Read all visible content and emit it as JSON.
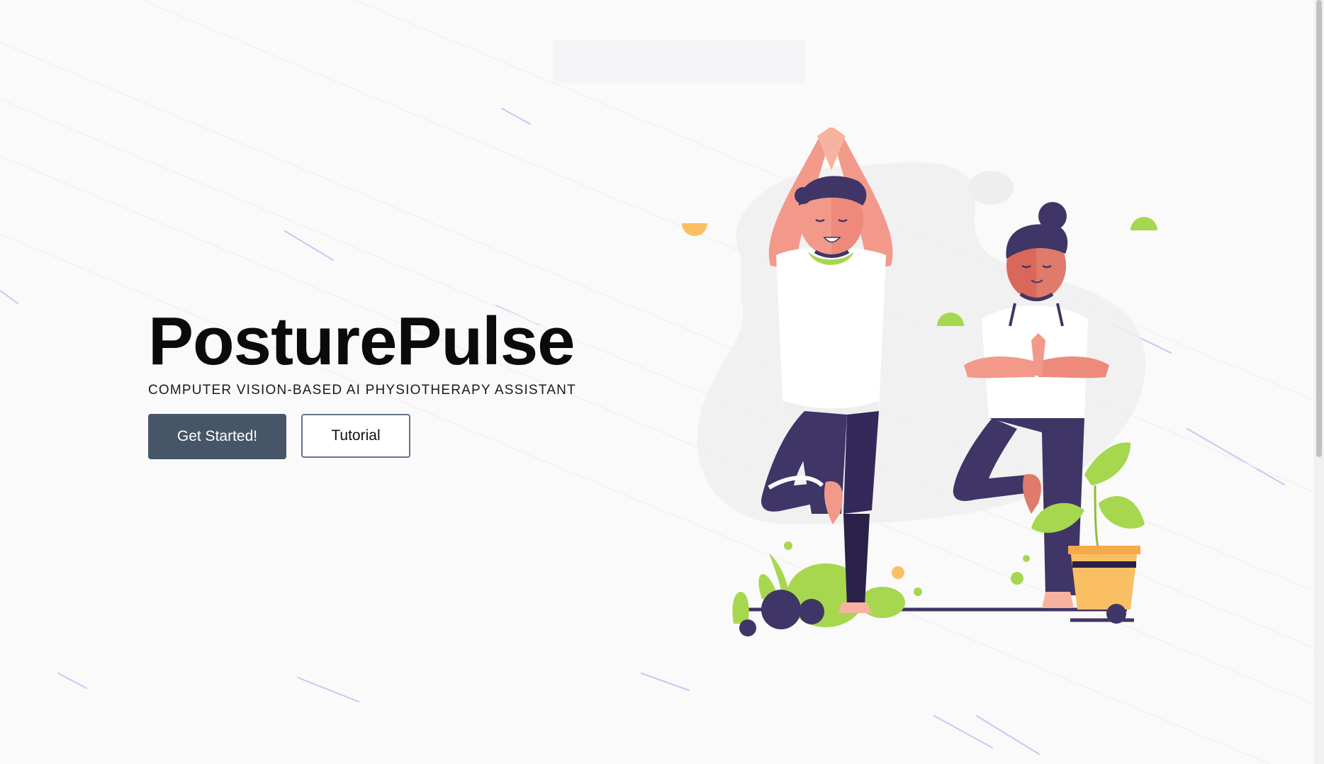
{
  "hero": {
    "title": "PosturePulse",
    "subtitle": "COMPUTER VISION-BASED AI PHYSIOTHERAPY ASSISTANT",
    "primary_button": "Get Started!",
    "secondary_button": "Tutorial"
  },
  "colors": {
    "background": "#fafafa",
    "primary_button": "#475569",
    "secondary_border": "#64748b",
    "title": "#0b0b0b",
    "figure_dark": "#3f3566",
    "skin": "#f2998a",
    "leaf_green": "#a6d74e",
    "pot_orange": "#fbbf63"
  },
  "icons": {
    "illustration": "yoga-couple-illustration"
  }
}
